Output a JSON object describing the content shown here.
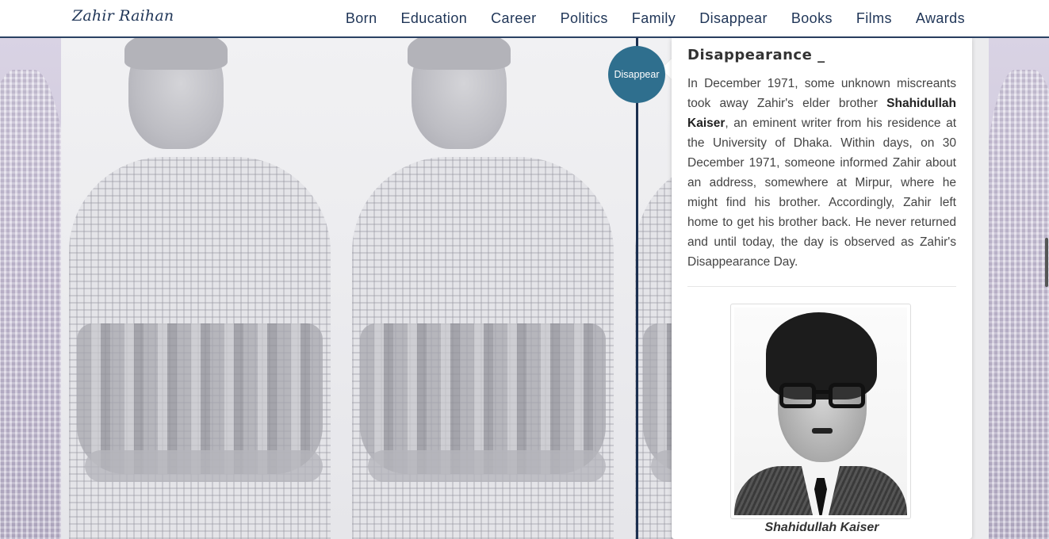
{
  "brand": "Zahir Raihan",
  "nav": [
    "Born",
    "Education",
    "Career",
    "Politics",
    "Family",
    "Disappear",
    "Books",
    "Films",
    "Awards"
  ],
  "timeline": {
    "badge": "Disappear"
  },
  "section": {
    "title": "Disappearance _",
    "body_parts": {
      "p1": "In December 1971, some unknown miscreants took away Zahir's elder brother ",
      "bold": "Shahidullah Kaiser",
      "p2": ", an eminent writer from his residence at the University of Dhaka. Within days, on 30 December 1971, someone informed Zahir about an address, somewhere at Mirpur, where he might find his brother. Accordingly, Zahir left home to get his brother back. He never returned and until today, the day is observed as Zahir's Disappearance Day."
    },
    "image_caption": "Shahidullah Kaiser"
  },
  "colors": {
    "navy": "#1f3557",
    "badge": "#2f6f8e",
    "timeline_line": "#1b2f4f"
  }
}
